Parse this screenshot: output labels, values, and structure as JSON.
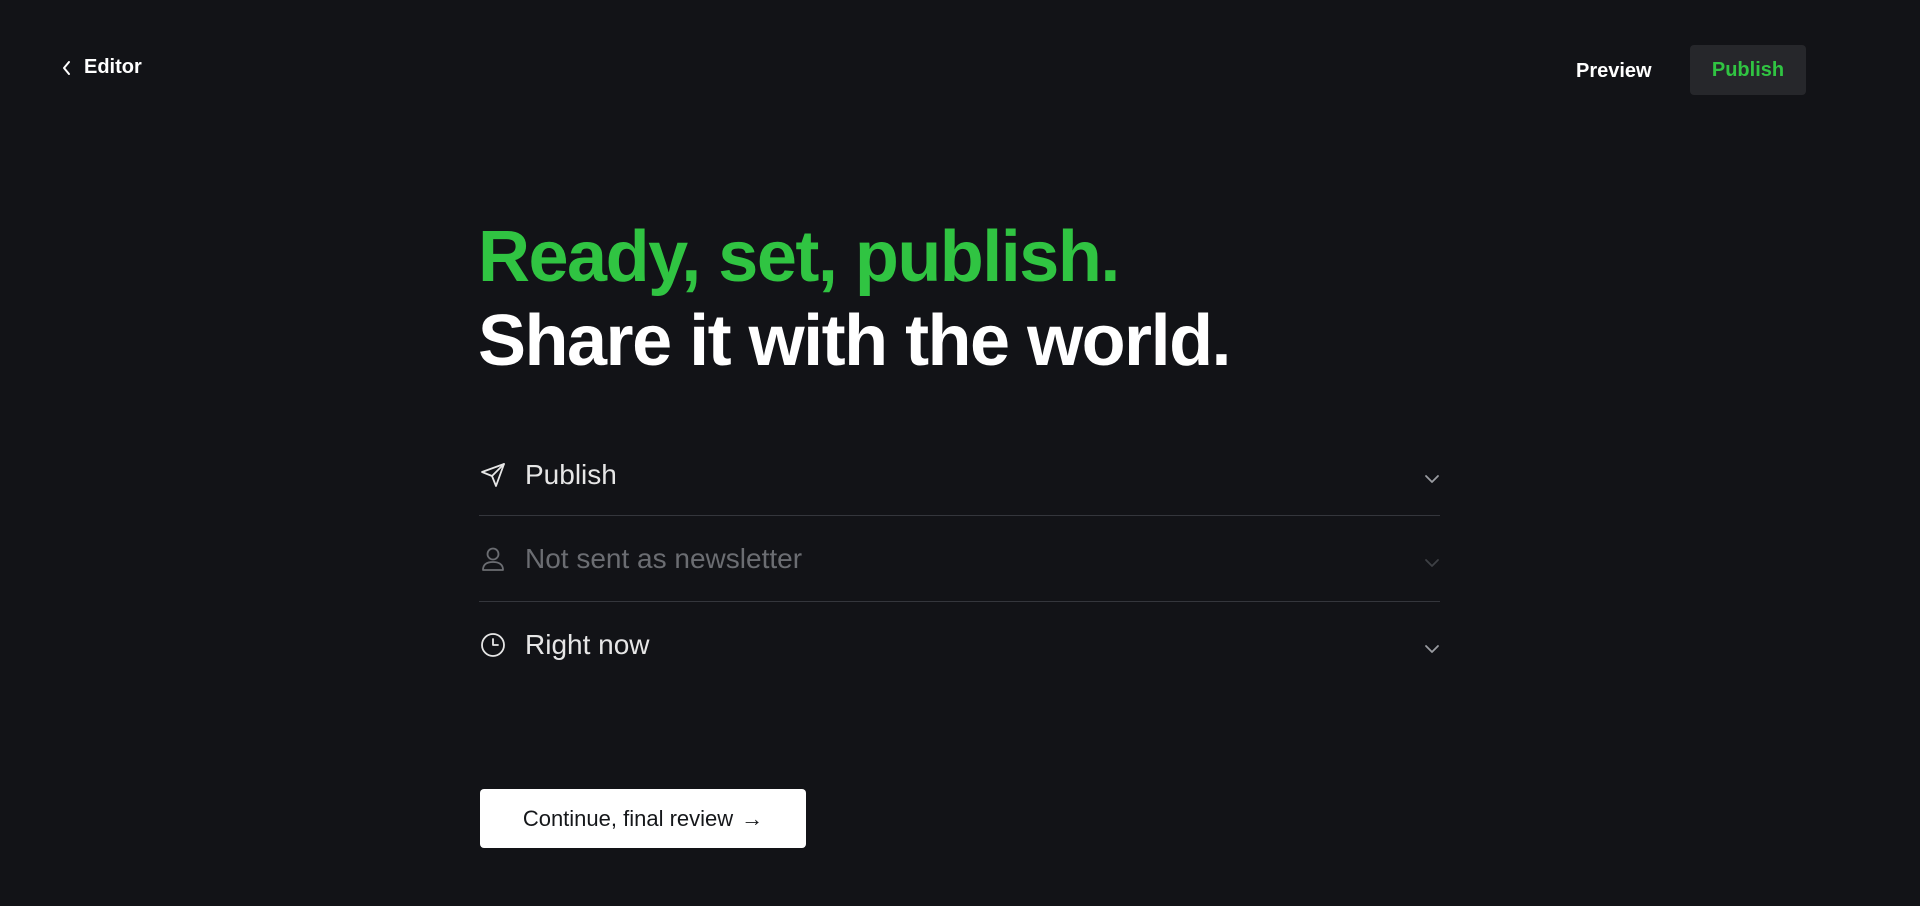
{
  "header": {
    "back_label": "Editor",
    "preview_label": "Preview",
    "publish_label": "Publish"
  },
  "headline": {
    "line1": "Ready, set, publish.",
    "line2": "Share it with the world."
  },
  "options": [
    {
      "label": "Publish",
      "icon": "send-icon",
      "enabled": true
    },
    {
      "label": "Not sent as newsletter",
      "icon": "user-icon",
      "enabled": false
    },
    {
      "label": "Right now",
      "icon": "clock-icon",
      "enabled": true
    }
  ],
  "footer": {
    "continue_label": "Continue, final review",
    "continue_arrow": "→"
  },
  "colors": {
    "background": "#121317",
    "accent_green": "#30c442",
    "button_dark": "#26272b",
    "divider": "#34363c",
    "muted_text": "#6b6d72"
  }
}
